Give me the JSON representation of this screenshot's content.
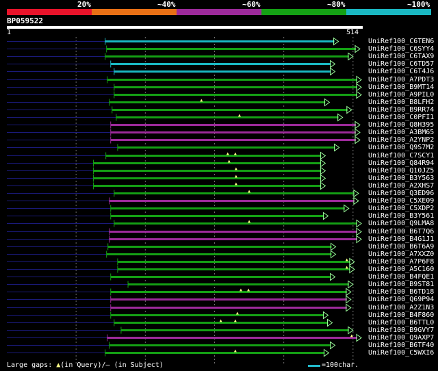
{
  "legend": {
    "labels": [
      "20%",
      "~40%",
      "~60%",
      "~80%",
      "~100%"
    ],
    "colors": [
      "#e8132a",
      "#e87015",
      "#9d2a9b",
      "#14a014",
      "#1ab8c2"
    ]
  },
  "query": {
    "id": "BP059522",
    "start": "1",
    "end": "514",
    "length": 514
  },
  "hits": [
    {
      "name": "UniRef100_C6TEN6",
      "start": 142,
      "end": 479,
      "color": "#1ab8c2",
      "gaps": []
    },
    {
      "name": "UniRef100_C6SYY4",
      "start": 144,
      "end": 510,
      "color": "#14a014",
      "gaps": []
    },
    {
      "name": "UniRef100_C6TAX9",
      "start": 142,
      "end": 500,
      "color": "#14a014",
      "gaps": []
    },
    {
      "name": "UniRef100_C6TD57",
      "start": 150,
      "end": 474,
      "color": "#1ab8c2",
      "gaps": []
    },
    {
      "name": "UniRef100_C6T4J6",
      "start": 155,
      "end": 474,
      "color": "#1ab8c2",
      "gaps": []
    },
    {
      "name": "UniRef100_A7PDT3",
      "start": 145,
      "end": 514,
      "color": "#14a014",
      "gaps": []
    },
    {
      "name": "UniRef100_B9MT14",
      "start": 155,
      "end": 514,
      "color": "#14a014",
      "gaps": []
    },
    {
      "name": "UniRef100_A9PIL0",
      "start": 155,
      "end": 514,
      "color": "#14a014",
      "gaps": []
    },
    {
      "name": "UniRef100_B8LFH2",
      "start": 148,
      "end": 466,
      "color": "#14a014",
      "gaps": [
        281
      ]
    },
    {
      "name": "UniRef100_B9RR74",
      "start": 152,
      "end": 498,
      "color": "#14a014",
      "gaps": []
    },
    {
      "name": "UniRef100_C0PFI1",
      "start": 158,
      "end": 485,
      "color": "#14a014",
      "gaps": [
        336
      ]
    },
    {
      "name": "UniRef100_Q8H395",
      "start": 150,
      "end": 510,
      "color": "#9d2a9b",
      "gaps": []
    },
    {
      "name": "UniRef100_A3BM65",
      "start": 150,
      "end": 510,
      "color": "#9d2a9b",
      "gaps": []
    },
    {
      "name": "UniRef100_A2YNP2",
      "start": 150,
      "end": 510,
      "color": "#9d2a9b",
      "gaps": []
    },
    {
      "name": "UniRef100_Q9S7M2",
      "start": 160,
      "end": 480,
      "color": "#14a014",
      "gaps": []
    },
    {
      "name": "UniRef100_C7SCY1",
      "start": 143,
      "end": 460,
      "color": "#14a014",
      "gaps": [
        319,
        330
      ]
    },
    {
      "name": "UniRef100_Q84R94",
      "start": 125,
      "end": 460,
      "color": "#14a014",
      "gaps": [
        321
      ]
    },
    {
      "name": "UniRef100_Q10JZ5",
      "start": 125,
      "end": 460,
      "color": "#14a014",
      "gaps": [
        331
      ]
    },
    {
      "name": "UniRef100_B3Y563",
      "start": 125,
      "end": 460,
      "color": "#14a014",
      "gaps": [
        331
      ]
    },
    {
      "name": "UniRef100_A2XHS7",
      "start": 125,
      "end": 460,
      "color": "#14a014",
      "gaps": [
        331
      ]
    },
    {
      "name": "UniRef100_Q3ED96",
      "start": 155,
      "end": 508,
      "color": "#14a014",
      "gaps": [
        350
      ]
    },
    {
      "name": "UniRef100_C5XE09",
      "start": 148,
      "end": 508,
      "color": "#9d2a9b",
      "gaps": []
    },
    {
      "name": "UniRef100_C5XDP2",
      "start": 150,
      "end": 494,
      "color": "#14a014",
      "gaps": []
    },
    {
      "name": "UniRef100_B3Y561",
      "start": 150,
      "end": 464,
      "color": "#14a014",
      "gaps": []
    },
    {
      "name": "UniRef100_Q9LMA8",
      "start": 155,
      "end": 514,
      "color": "#14a014",
      "gaps": [
        350
      ]
    },
    {
      "name": "UniRef100_B6T7Q6",
      "start": 148,
      "end": 514,
      "color": "#9d2a9b",
      "gaps": []
    },
    {
      "name": "UniRef100_B4G1J1",
      "start": 148,
      "end": 514,
      "color": "#9d2a9b",
      "gaps": []
    },
    {
      "name": "UniRef100_B6T6A9",
      "start": 146,
      "end": 475,
      "color": "#14a014",
      "gaps": []
    },
    {
      "name": "UniRef100_A7XXZ0",
      "start": 144,
      "end": 475,
      "color": "#14a014",
      "gaps": []
    },
    {
      "name": "UniRef100_A7P6F8",
      "start": 160,
      "end": 502,
      "color": "#14a014",
      "gaps": [
        491
      ]
    },
    {
      "name": "UniRef100_A5C160",
      "start": 160,
      "end": 502,
      "color": "#14a014",
      "gaps": [
        491
      ]
    },
    {
      "name": "UniRef100_B4FQE1",
      "start": 150,
      "end": 474,
      "color": "#14a014",
      "gaps": []
    },
    {
      "name": "UniRef100_B9ST81",
      "start": 175,
      "end": 500,
      "color": "#14a014",
      "gaps": []
    },
    {
      "name": "UniRef100_B6TD18",
      "start": 150,
      "end": 497,
      "color": "#14a014",
      "gaps": [
        338,
        349
      ]
    },
    {
      "name": "UniRef100_Q69P94",
      "start": 150,
      "end": 497,
      "color": "#9d2a9b",
      "gaps": []
    },
    {
      "name": "UniRef100_A2Z1N3",
      "start": 150,
      "end": 497,
      "color": "#9d2a9b",
      "gaps": []
    },
    {
      "name": "UniRef100_B4F860",
      "start": 150,
      "end": 464,
      "color": "#14a014",
      "gaps": [
        333
      ]
    },
    {
      "name": "UniRef100_B6TTL0",
      "start": 155,
      "end": 470,
      "color": "#14a014",
      "gaps": [
        309,
        330
      ]
    },
    {
      "name": "UniRef100_B9GVY7",
      "start": 165,
      "end": 500,
      "color": "#14a014",
      "gaps": []
    },
    {
      "name": "UniRef100_Q9AXP7",
      "start": 145,
      "end": 520,
      "color": "#9d2a9b",
      "gaps": [
        498
      ]
    },
    {
      "name": "UniRef100_B6TF40",
      "start": 148,
      "end": 474,
      "color": "#14a014",
      "gaps": []
    },
    {
      "name": "UniRef100_C5WXI6",
      "start": 142,
      "end": 465,
      "color": "#14a014",
      "gaps": [
        330
      ]
    }
  ],
  "footer": {
    "prefix": "Large gaps: ",
    "query_gap_symbol": "▲",
    "query_gap_text": "(in Query)/",
    "subject_gap_symbol": "—",
    "subject_gap_text": " (in Subject)",
    "scale_text": "=100char."
  }
}
